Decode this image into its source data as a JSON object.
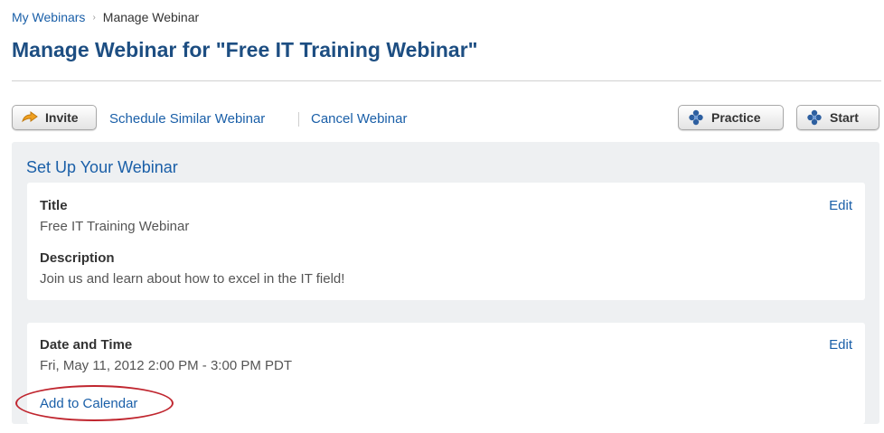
{
  "breadcrumb": {
    "parent": "My Webinars",
    "separator": "›",
    "current": "Manage Webinar"
  },
  "page_title": "Manage Webinar for \"Free IT Training Webinar\"",
  "toolbar": {
    "invite_label": "Invite",
    "schedule_similar_label": "Schedule Similar Webinar",
    "cancel_label": "Cancel Webinar",
    "practice_label": "Practice",
    "start_label": "Start"
  },
  "setup": {
    "heading": "Set Up Your Webinar",
    "details": {
      "title_label": "Title",
      "title_value": "Free IT Training Webinar",
      "description_label": "Description",
      "description_value": "Join us and learn about how to excel in the IT field!",
      "edit_label": "Edit"
    },
    "datetime": {
      "label": "Date and Time",
      "value": "Fri, May 11, 2012 2:00 PM - 3:00 PM PDT",
      "edit_label": "Edit",
      "add_to_calendar_label": "Add to Calendar"
    }
  },
  "colors": {
    "link": "#1a5fa8",
    "title": "#1d4e82",
    "highlight_circle": "#c0262f",
    "panel_background": "#eef0f2"
  },
  "icons": {
    "invite": "arrow-right-icon",
    "practice": "gear-cluster-icon",
    "start": "gear-cluster-icon"
  }
}
